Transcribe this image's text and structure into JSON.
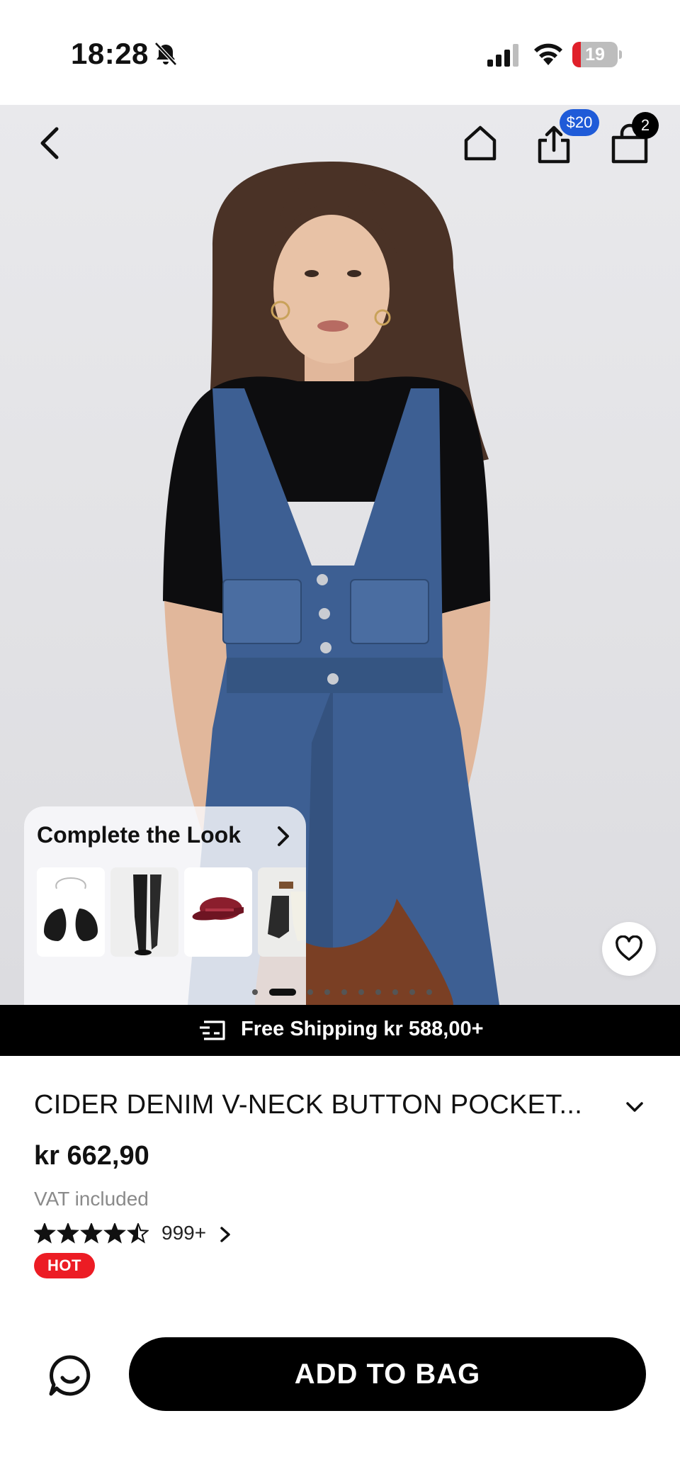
{
  "status_bar": {
    "time": "18:28",
    "battery_level": "19",
    "battery_fraction": 0.19,
    "icons": [
      "bell-off-icon",
      "signal-icon",
      "wifi-icon",
      "battery-icon"
    ]
  },
  "top_nav": {
    "icons": [
      "back-chevron-icon",
      "home-icon",
      "share-icon",
      "shopping-bag-icon"
    ],
    "share_badge": "$20",
    "bag_count": "2"
  },
  "complete_the_look": {
    "title": "Complete the Look",
    "items": [
      "bra-thumbnail",
      "tights-thumbnail",
      "red-cap-thumbnail",
      "socks-thumbnail"
    ]
  },
  "gallery": {
    "dot_count": 10,
    "active_index": 1
  },
  "shipping_banner": {
    "icon": "shipping-truck-icon",
    "text": "Free Shipping kr 588,00+"
  },
  "product": {
    "title": "CIDER DENIM V-NECK BUTTON POCKET...",
    "price": "kr 662,90",
    "vat_note": "VAT included",
    "rating": 4.5,
    "rating_count": "999+",
    "badge": "HOT"
  },
  "bottom_bar": {
    "chat_icon": "chat-icon",
    "add_to_bag_label": "ADD TO BAG"
  },
  "colors": {
    "accent_blue": "#1f5bd8",
    "hot_red": "#ec1c24",
    "black": "#000000"
  }
}
